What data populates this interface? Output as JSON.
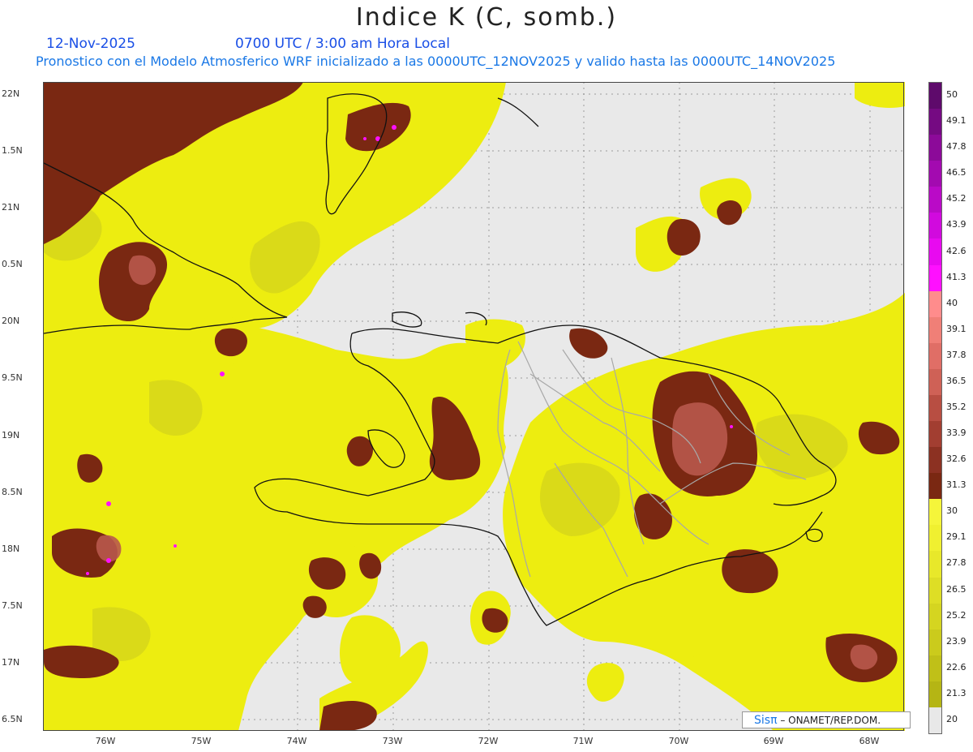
{
  "title": "Indice K (C, somb.)",
  "date": "12-Nov-2025",
  "time": "0700 UTC / 3:00 am Hora Local",
  "forecast_line": "Pronostico con el Modelo Atmosferico WRF inicializado a las 0000UTC_12NOV2025 y valido hasta las  0000UTC_14NOV2025",
  "lat_labels": [
    "22N",
    "1.5N",
    "21N",
    "0.5N",
    "20N",
    "9.5N",
    "19N",
    "8.5N",
    "18N",
    "7.5N",
    "17N",
    "6.5N"
  ],
  "lon_labels": [
    "76W",
    "75W",
    "74W",
    "73W",
    "72W",
    "71W",
    "70W",
    "69W",
    "68W"
  ],
  "colorbar": {
    "labels": [
      "50",
      "49.1",
      "47.8",
      "46.5",
      "45.2",
      "43.9",
      "42.6",
      "41.3",
      "40",
      "39.1",
      "37.8",
      "36.5",
      "35.2",
      "33.9",
      "32.6",
      "31.3",
      "30",
      "29.1",
      "27.8",
      "26.5",
      "25.2",
      "23.9",
      "22.6",
      "21.3",
      "20"
    ],
    "colors": [
      "#5e0a6b",
      "#750a82",
      "#8c0a99",
      "#a30ab0",
      "#ba0ac7",
      "#d10ade",
      "#e80af0",
      "#ff10ff",
      "#ff8c8c",
      "#f07f77",
      "#e06e66",
      "#cf6156",
      "#b84e42",
      "#a23e31",
      "#8c3122",
      "#7a2812",
      "#f5f53a",
      "#f0f030",
      "#e8e82a",
      "#dede25",
      "#d5d520",
      "#cbcb1c",
      "#c0c018",
      "#b5b514",
      "#e8e8e8"
    ]
  },
  "credit": {
    "brand": "Sisπ",
    "text": " – ONAMET/REP.DOM."
  },
  "colors": {
    "title_blue": "#1a4fe6",
    "subtitle_blue": "#1a78e6",
    "no_data": "#e9e9e9",
    "yellow": "#f2f200",
    "brown": "#7a2812"
  }
}
